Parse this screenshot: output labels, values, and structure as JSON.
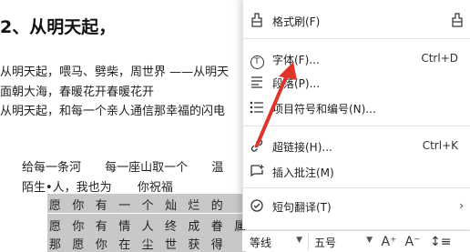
{
  "document": {
    "heading": "2、从明天起，",
    "lines": [
      "从明天起，喂马、劈柴，周世界 ——从明天",
      "面朝大海，春暖花开春暖花开",
      "从明天起，和每一个亲人通信那幸福的闪电"
    ],
    "poem_line_1": [
      "给每一条河",
      "每一座山取一个",
      "温"
    ],
    "poem_line_2": [
      "陌生•人，我也为",
      "你祝福"
    ],
    "selected_rows": [
      "愿你有一个灿烂的",
      "愿你有情人终成眷属",
      "那愿你在尘世获得"
    ]
  },
  "context_menu": {
    "items": [
      {
        "label": "格式刷(F)",
        "shortcut": "",
        "icon": "format-painter-icon"
      },
      {
        "label": "字体(F)...",
        "shortcut": "Ctrl+D",
        "icon": "font-icon"
      },
      {
        "label": "段落(P)...",
        "shortcut": "",
        "icon": "paragraph-icon"
      },
      {
        "label": "项目符号和编号(N)...",
        "shortcut": "",
        "icon": "bullet-list-icon"
      },
      {
        "label": "超链接(H)...",
        "shortcut": "Ctrl+K",
        "icon": "link-icon"
      },
      {
        "label": "插入批注(M)",
        "shortcut": "",
        "icon": "comment-icon"
      },
      {
        "label": "短句翻译(T)",
        "shortcut": "",
        "icon": "translate-icon"
      }
    ]
  },
  "mini_toolbar": {
    "font_name": "等线",
    "font_size": "五号",
    "grow_font": "A⁺",
    "shrink_font": "A⁻",
    "line_spacing": "↕≡"
  },
  "colors": {
    "arrow": "#e0342b",
    "selection": "#c8c8c8"
  }
}
